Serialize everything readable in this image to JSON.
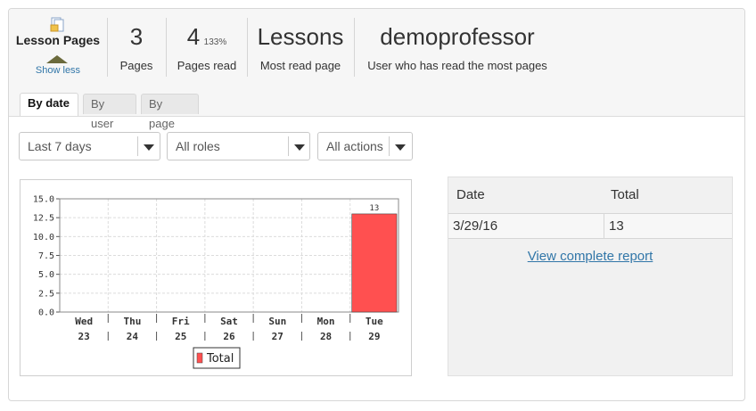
{
  "summary": {
    "title": "Lesson Pages",
    "toggle_label": "Show less",
    "stats": [
      {
        "value": "3",
        "extra": "",
        "label": "Pages"
      },
      {
        "value": "4",
        "extra": "133%",
        "label": "Pages read"
      },
      {
        "value": "Lessons",
        "extra": "",
        "label": "Most read page"
      },
      {
        "value": "demoprofessor",
        "extra": "",
        "label": "User who has read the most pages"
      }
    ]
  },
  "tabs": [
    {
      "label": "By date",
      "active": true
    },
    {
      "label": "By user",
      "active": false
    },
    {
      "label": "By page",
      "active": false
    }
  ],
  "filters": {
    "period": "Last 7 days",
    "roles": "All roles",
    "actions": "All actions"
  },
  "chart_data": {
    "type": "bar",
    "categories": [
      [
        "Wed",
        "23"
      ],
      [
        "Thu",
        "24"
      ],
      [
        "Fri",
        "25"
      ],
      [
        "Sat",
        "26"
      ],
      [
        "Sun",
        "27"
      ],
      [
        "Mon",
        "28"
      ],
      [
        "Tue",
        "29"
      ]
    ],
    "series": [
      {
        "name": "Total",
        "values": [
          0,
          0,
          0,
          0,
          0,
          0,
          13
        ],
        "color": "#ff5050"
      }
    ],
    "data_labels": [
      "",
      "",
      "",
      "",
      "",
      "",
      "13"
    ],
    "yticks": [
      "0.0",
      "2.5",
      "5.0",
      "7.5",
      "10.0",
      "12.5",
      "15.0"
    ],
    "ylim": [
      0,
      15
    ],
    "grid": true,
    "legend": "bottom"
  },
  "table": {
    "headers": [
      "Date",
      "Total"
    ],
    "rows": [
      [
        "3/29/16",
        "13"
      ]
    ],
    "link_label": "View complete report"
  }
}
